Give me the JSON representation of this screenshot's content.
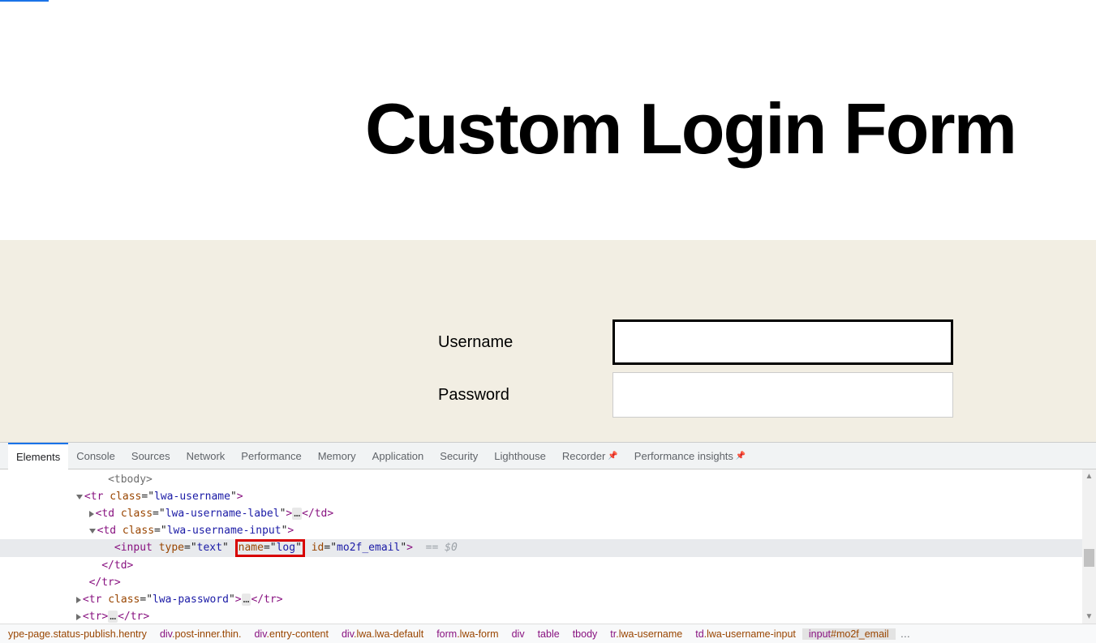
{
  "page": {
    "title": "Custom Login Form",
    "form": {
      "username_label": "Username",
      "username_value": "",
      "password_label": "Password",
      "password_value": ""
    }
  },
  "devtools": {
    "tabs": [
      "Elements",
      "Console",
      "Sources",
      "Network",
      "Performance",
      "Memory",
      "Application",
      "Security",
      "Lighthouse",
      "Recorder",
      "Performance insights"
    ],
    "active_tab": "Elements",
    "dom_lines": {
      "l0": "<tbody>",
      "l1_open": "<tr class=\"lwa-username\">",
      "l2_td_label": "<td class=\"lwa-username-label\">…</td>",
      "l3_td_input_open": "<td class=\"lwa-username-input\">",
      "l4_input": "<input type=\"text\" name=\"log\" id=\"mo2f_email\">",
      "l4_eq": " == $0",
      "l5_td_close": "</td>",
      "l6_tr_close": "</tr>",
      "l7_tr_pw": "<tr class=\"lwa-password\">…</tr>",
      "l8_tr": "<tr>…</tr>"
    },
    "highlight_attr": "name=\"log\"",
    "breadcrumbs": [
      "ype-page.status-publish.hentry",
      "div.post-inner.thin.",
      "div.entry-content",
      "div.lwa.lwa-default",
      "form.lwa-form",
      "div",
      "table",
      "tbody",
      "tr.lwa-username",
      "td.lwa-username-input",
      "input#mo2f_email"
    ],
    "breadcrumb_active": "input#mo2f_email"
  }
}
